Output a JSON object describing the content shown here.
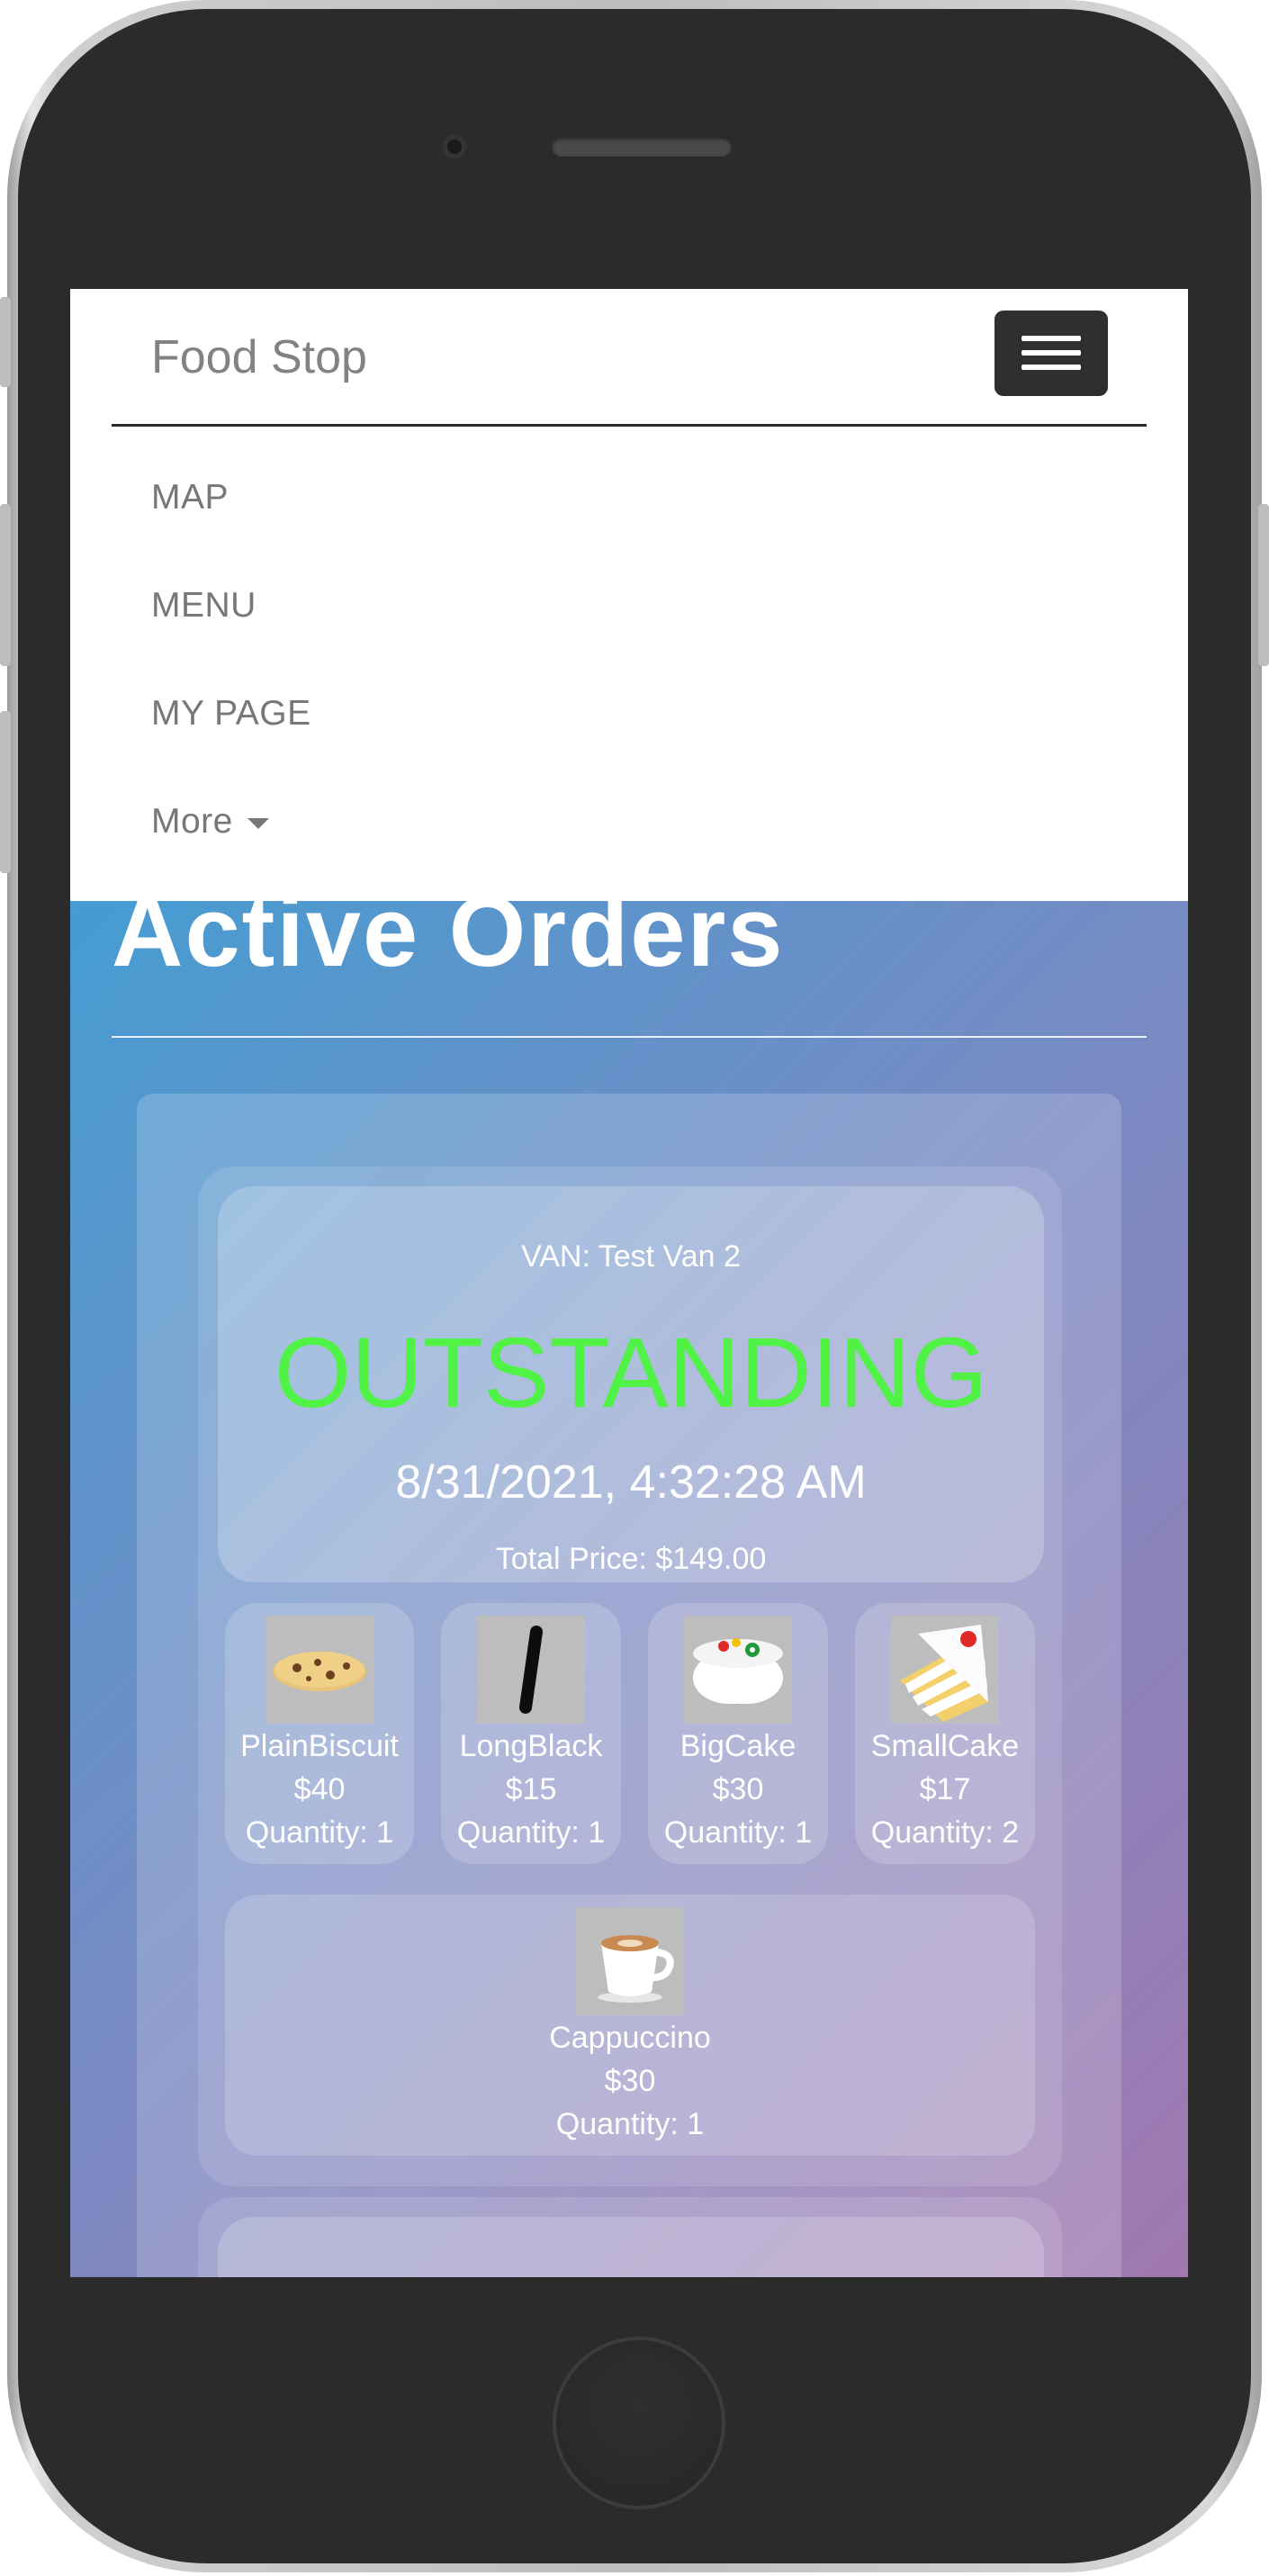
{
  "navbar": {
    "brand": "Food Stop",
    "items": [
      {
        "label": "MAP"
      },
      {
        "label": "MENU"
      },
      {
        "label": "MY PAGE"
      },
      {
        "label": "More"
      }
    ]
  },
  "page": {
    "title": "Active Orders"
  },
  "order": {
    "van": "VAN: Test Van 2",
    "status": "OUTSTANDING",
    "status_color": "#4ff245",
    "datetime": "8/31/2021, 4:32:28 AM",
    "total": "Total Price: $149.00",
    "items": [
      {
        "name": "PlainBiscuit",
        "price": "$40",
        "quantity": "Quantity: 1",
        "icon": "biscuit-icon"
      },
      {
        "name": "LongBlack",
        "price": "$15",
        "quantity": "Quantity: 1",
        "icon": "long-black-icon"
      },
      {
        "name": "BigCake",
        "price": "$30",
        "quantity": "Quantity: 1",
        "icon": "big-cake-icon"
      },
      {
        "name": "SmallCake",
        "price": "$17",
        "quantity": "Quantity: 2",
        "icon": "cake-slice-icon"
      },
      {
        "name": "Cappuccino",
        "price": "$30",
        "quantity": "Quantity: 1",
        "icon": "coffee-cup-icon"
      }
    ]
  },
  "colors": {
    "screen_gradient_start": "#1fa8df",
    "screen_gradient_end": "#a178b0",
    "status": "#4ff245"
  }
}
